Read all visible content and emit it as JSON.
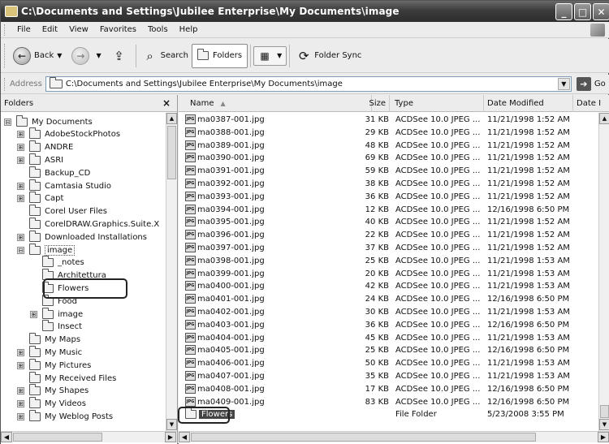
{
  "window": {
    "title": "C:\\Documents and Settings\\Jubilee Enterprise\\My Documents\\image",
    "minimize": "_",
    "maximize": "□",
    "close": "✕"
  },
  "menu": [
    "File",
    "Edit",
    "View",
    "Favorites",
    "Tools",
    "Help"
  ],
  "toolbar": {
    "back": "Back",
    "search": "Search",
    "folders": "Folders",
    "folder_sync": "Folder Sync"
  },
  "address": {
    "label": "Address",
    "value": "C:\\Documents and Settings\\Jubilee Enterprise\\My Documents\\image",
    "go": "Go"
  },
  "folders_pane": {
    "title": "Folders",
    "close": "×",
    "items": [
      {
        "label": "My Documents",
        "expander": "⊟",
        "level": 0
      },
      {
        "label": "AdobeStockPhotos",
        "expander": "⊞",
        "level": 1
      },
      {
        "label": "ANDRE",
        "expander": "⊞",
        "level": 1
      },
      {
        "label": "ASRI",
        "expander": "⊞",
        "level": 1
      },
      {
        "label": "Backup_CD",
        "expander": "",
        "level": 1
      },
      {
        "label": "Camtasia Studio",
        "expander": "⊞",
        "level": 1
      },
      {
        "label": "Capt",
        "expander": "⊞",
        "level": 1
      },
      {
        "label": "Corel User Files",
        "expander": "",
        "level": 1
      },
      {
        "label": "CorelDRAW.Graphics.Suite.X",
        "expander": "",
        "level": 1
      },
      {
        "label": "Downloaded Installations",
        "expander": "⊞",
        "level": 1
      },
      {
        "label": "image",
        "expander": "⊟",
        "level": 1
      },
      {
        "label": "_notes",
        "expander": "",
        "level": 2
      },
      {
        "label": "Architettura",
        "expander": "",
        "level": 2
      },
      {
        "label": "Flowers",
        "expander": "",
        "level": 2
      },
      {
        "label": "Food",
        "expander": "",
        "level": 2
      },
      {
        "label": "image",
        "expander": "⊞",
        "level": 2
      },
      {
        "label": "Insect",
        "expander": "",
        "level": 2
      },
      {
        "label": "My Maps",
        "expander": "",
        "level": 1
      },
      {
        "label": "My Music",
        "expander": "⊞",
        "level": 1
      },
      {
        "label": "My Pictures",
        "expander": "⊞",
        "level": 1
      },
      {
        "label": "My Received Files",
        "expander": "",
        "level": 1
      },
      {
        "label": "My Shapes",
        "expander": "⊞",
        "level": 1
      },
      {
        "label": "My Videos",
        "expander": "⊞",
        "level": 1
      },
      {
        "label": "My Weblog Posts",
        "expander": "⊞",
        "level": 1
      }
    ]
  },
  "file_list": {
    "columns": [
      "Name",
      "Size",
      "Type",
      "Date Modified",
      "Date I"
    ],
    "sort_indicator": "▲",
    "rows": [
      {
        "name": "ma0387-001.jpg",
        "size": "31 KB",
        "type": "ACDSee 10.0 JPEG ...",
        "date": "11/21/1998 1:52 AM"
      },
      {
        "name": "ma0388-001.jpg",
        "size": "29 KB",
        "type": "ACDSee 10.0 JPEG ...",
        "date": "11/21/1998 1:52 AM"
      },
      {
        "name": "ma0389-001.jpg",
        "size": "48 KB",
        "type": "ACDSee 10.0 JPEG ...",
        "date": "11/21/1998 1:52 AM"
      },
      {
        "name": "ma0390-001.jpg",
        "size": "69 KB",
        "type": "ACDSee 10.0 JPEG ...",
        "date": "11/21/1998 1:52 AM"
      },
      {
        "name": "ma0391-001.jpg",
        "size": "59 KB",
        "type": "ACDSee 10.0 JPEG ...",
        "date": "11/21/1998 1:52 AM"
      },
      {
        "name": "ma0392-001.jpg",
        "size": "38 KB",
        "type": "ACDSee 10.0 JPEG ...",
        "date": "11/21/1998 1:52 AM"
      },
      {
        "name": "ma0393-001.jpg",
        "size": "36 KB",
        "type": "ACDSee 10.0 JPEG ...",
        "date": "11/21/1998 1:52 AM"
      },
      {
        "name": "ma0394-001.jpg",
        "size": "12 KB",
        "type": "ACDSee 10.0 JPEG ...",
        "date": "12/16/1998 6:50 PM"
      },
      {
        "name": "ma0395-001.jpg",
        "size": "40 KB",
        "type": "ACDSee 10.0 JPEG ...",
        "date": "11/21/1998 1:52 AM"
      },
      {
        "name": "ma0396-001.jpg",
        "size": "22 KB",
        "type": "ACDSee 10.0 JPEG ...",
        "date": "11/21/1998 1:52 AM"
      },
      {
        "name": "ma0397-001.jpg",
        "size": "37 KB",
        "type": "ACDSee 10.0 JPEG ...",
        "date": "11/21/1998 1:52 AM"
      },
      {
        "name": "ma0398-001.jpg",
        "size": "25 KB",
        "type": "ACDSee 10.0 JPEG ...",
        "date": "11/21/1998 1:53 AM"
      },
      {
        "name": "ma0399-001.jpg",
        "size": "20 KB",
        "type": "ACDSee 10.0 JPEG ...",
        "date": "11/21/1998 1:53 AM"
      },
      {
        "name": "ma0400-001.jpg",
        "size": "42 KB",
        "type": "ACDSee 10.0 JPEG ...",
        "date": "11/21/1998 1:53 AM"
      },
      {
        "name": "ma0401-001.jpg",
        "size": "24 KB",
        "type": "ACDSee 10.0 JPEG ...",
        "date": "12/16/1998 6:50 PM"
      },
      {
        "name": "ma0402-001.jpg",
        "size": "30 KB",
        "type": "ACDSee 10.0 JPEG ...",
        "date": "11/21/1998 1:53 AM"
      },
      {
        "name": "ma0403-001.jpg",
        "size": "36 KB",
        "type": "ACDSee 10.0 JPEG ...",
        "date": "12/16/1998 6:50 PM"
      },
      {
        "name": "ma0404-001.jpg",
        "size": "45 KB",
        "type": "ACDSee 10.0 JPEG ...",
        "date": "11/21/1998 1:53 AM"
      },
      {
        "name": "ma0405-001.jpg",
        "size": "25 KB",
        "type": "ACDSee 10.0 JPEG ...",
        "date": "12/16/1998 6:50 PM"
      },
      {
        "name": "ma0406-001.jpg",
        "size": "50 KB",
        "type": "ACDSee 10.0 JPEG ...",
        "date": "11/21/1998 1:53 AM"
      },
      {
        "name": "ma0407-001.jpg",
        "size": "35 KB",
        "type": "ACDSee 10.0 JPEG ...",
        "date": "11/21/1998 1:53 AM"
      },
      {
        "name": "ma0408-001.jpg",
        "size": "17 KB",
        "type": "ACDSee 10.0 JPEG ...",
        "date": "12/16/1998 6:50 PM"
      },
      {
        "name": "ma0409-001.jpg",
        "size": "83 KB",
        "type": "ACDSee 10.0 JPEG ...",
        "date": "12/16/1998 6:50 PM"
      },
      {
        "name": "Flowers",
        "size": "",
        "type": "File Folder",
        "date": "5/23/2008 3:55 PM",
        "is_folder": true
      }
    ]
  },
  "icons": {
    "back": "back-arrow-icon",
    "forward": "forward-arrow-icon",
    "up": "up-folder-icon",
    "search": "search-icon",
    "folders": "folders-icon",
    "views": "views-icon",
    "folder_sync": "folder-sync-icon",
    "go": "go-arrow-icon"
  }
}
